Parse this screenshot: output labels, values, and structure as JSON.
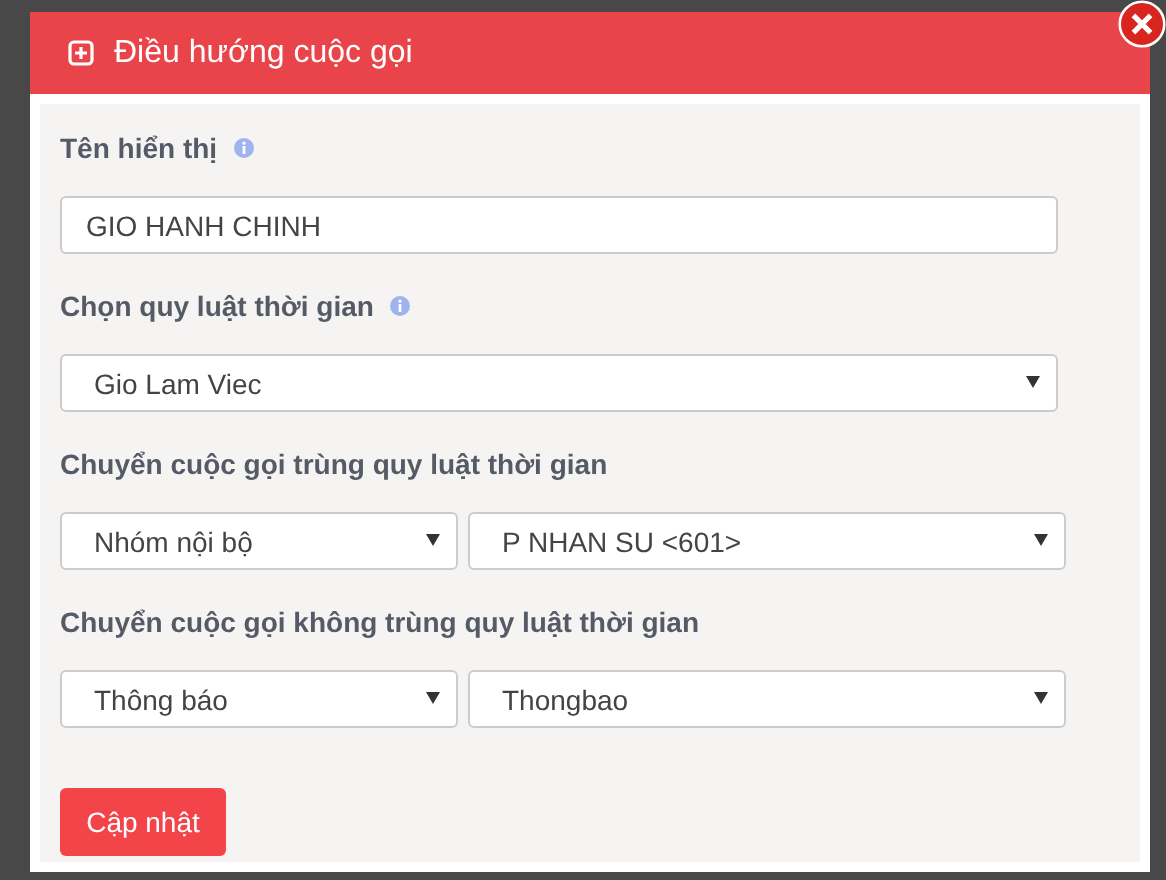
{
  "dialog": {
    "title": "Điều hướng cuộc gọi",
    "closable": true
  },
  "fields": [
    {
      "kind": "text",
      "label": "Tên hiển thị",
      "info": true,
      "value": "GIO HANH CHINH"
    },
    {
      "kind": "select",
      "label": "Chọn quy luật thời gian",
      "info": true,
      "options": [
        "Gio Lam Viec"
      ]
    },
    {
      "kind": "pair",
      "label": "Chuyển cuộc gọi trùng quy luật thời gian",
      "info": false,
      "options": [
        "Nhóm nội bộ",
        "P NHAN SU <601>"
      ]
    },
    {
      "kind": "pair",
      "label": "Chuyển cuộc gọi không trùng quy luật thời gian",
      "info": false,
      "options": [
        "Thông báo",
        "Thongbao"
      ]
    }
  ],
  "submit": "Cập nhật"
}
